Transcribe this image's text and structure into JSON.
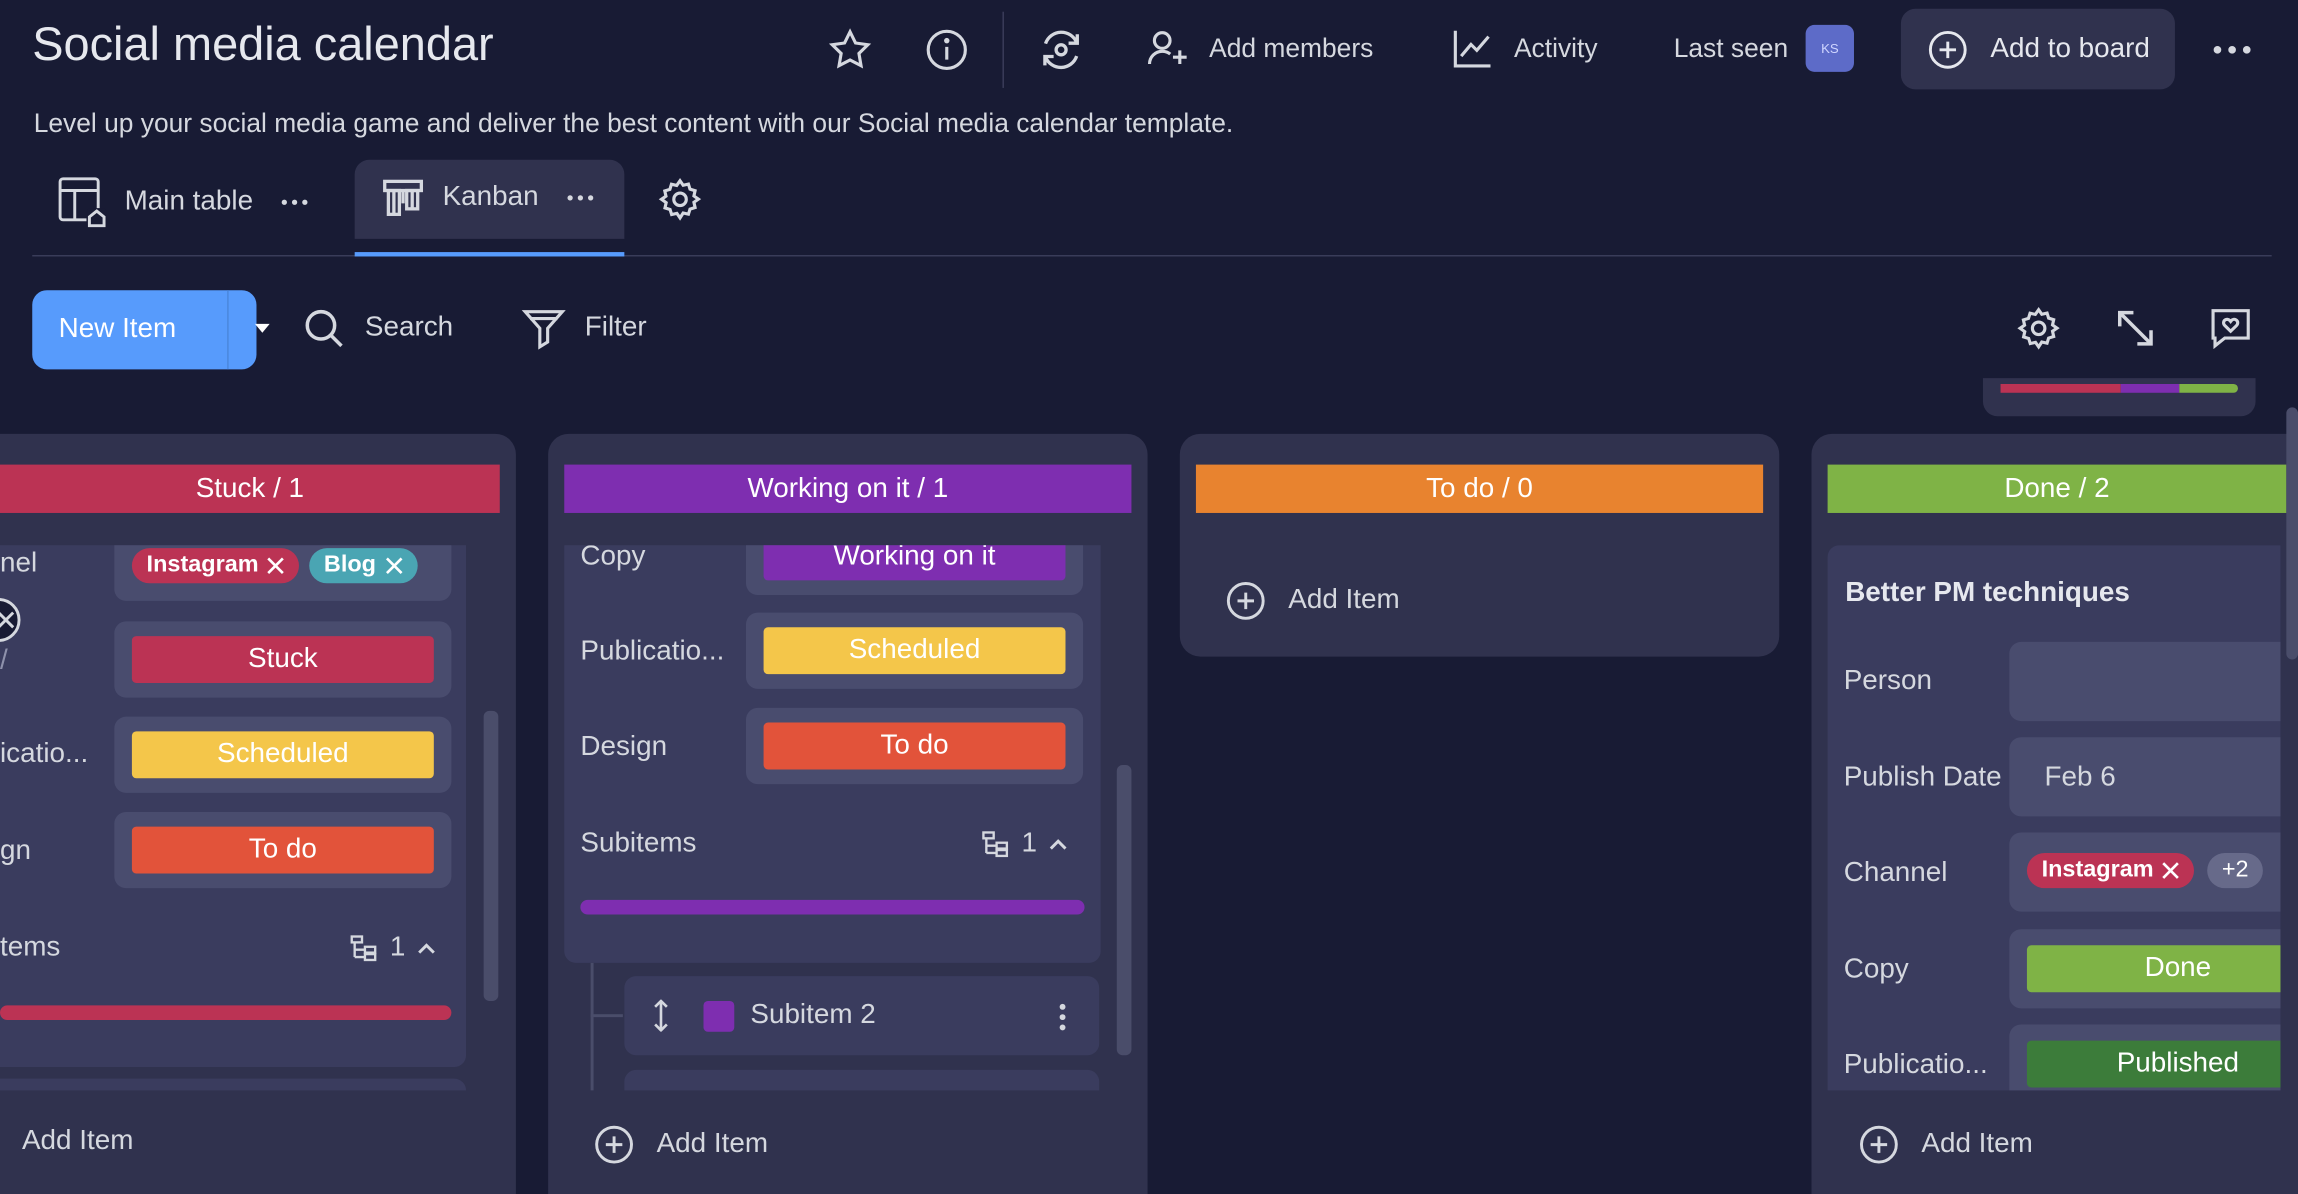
{
  "header": {
    "title": "Social media calendar",
    "description": "Level up your social media game and deliver the best content with our Social media calendar template.",
    "add_members": "Add members",
    "activity": "Activity",
    "last_seen": "Last seen",
    "avatar_initials": "KS",
    "add_to_board": "Add to board"
  },
  "views": {
    "tabs": [
      {
        "label": "Main table",
        "icon": "table-home-icon",
        "active": false
      },
      {
        "label": "Kanban",
        "icon": "kanban-icon",
        "active": true
      }
    ]
  },
  "toolbar": {
    "new_item": "New Item",
    "search": "Search",
    "filter": "Filter"
  },
  "columns": [
    {
      "title": "Stuck / 1",
      "color": "#bb3354",
      "rows": [
        {
          "label": "nel",
          "chips": [
            {
              "text": "Instagram",
              "color": "#bb3354"
            },
            {
              "text": "Blog",
              "color": "#4aa5b3"
            }
          ]
        },
        {
          "label": "/",
          "value": "Stuck",
          "color": "#bb3354"
        },
        {
          "label": "icatio...",
          "value": "Scheduled",
          "color": "#f4c64a"
        },
        {
          "label": "gn",
          "value": "To do",
          "color": "#e2533a"
        }
      ],
      "subitems_label": "tems",
      "subitems_count": "1",
      "add_item": "Add Item"
    },
    {
      "title": "Working on it / 1",
      "color": "#7e2eb0",
      "rows": [
        {
          "label": "Copy",
          "value": "Working on it",
          "color": "#7e2eb0"
        },
        {
          "label": "Publicatio...",
          "value": "Scheduled",
          "color": "#f4c64a"
        },
        {
          "label": "Design",
          "value": "To do",
          "color": "#e2533a"
        }
      ],
      "subitems_label": "Subitems",
      "subitems_count": "1",
      "subitem_name": "Subitem 2",
      "add_item": "Add Item"
    },
    {
      "title": "To do / 0",
      "color": "#e8832f",
      "add_item": "Add Item"
    },
    {
      "title": "Done / 2",
      "color": "#7fb346",
      "card_title": "Better PM techniques",
      "rows": [
        {
          "label": "Person",
          "value": ""
        },
        {
          "label": "Publish Date",
          "value": "Feb 6"
        },
        {
          "label": "Channel",
          "chip": "Instagram",
          "chip_color": "#bb3354",
          "more": "+2"
        },
        {
          "label": "Copy",
          "value": "Done",
          "color": "#7fb346"
        },
        {
          "label": "Publicatio...",
          "value": "Published",
          "color": "#3c7c3a"
        }
      ],
      "add_item": "Add Item"
    }
  ]
}
